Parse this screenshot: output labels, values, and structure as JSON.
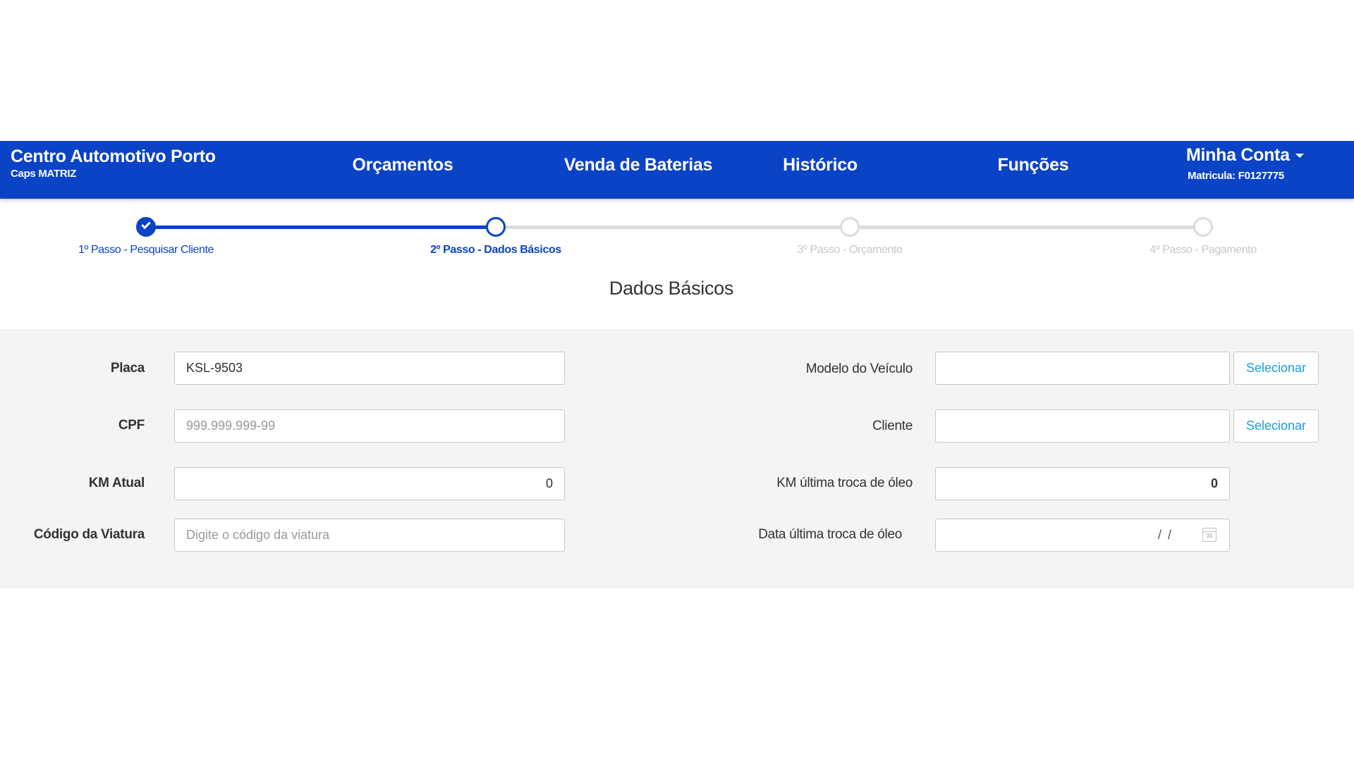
{
  "header": {
    "brand_name": "Centro Automotivo Porto",
    "brand_sub": "Caps MATRIZ",
    "nav": [
      "Orçamentos",
      "Venda de Baterias",
      "Histórico",
      "Funções"
    ],
    "account_label": "Minha Conta",
    "account_sub": "Matricula: F0127775",
    "bg_color": "#0a43c6"
  },
  "stepper": {
    "steps": [
      {
        "label": "1º Passo - Pesquisar Cliente",
        "state": "completed"
      },
      {
        "label": "2º Passo - Dados Básicos",
        "state": "current"
      },
      {
        "label": "3º Passo - Orçamento",
        "state": "pending"
      },
      {
        "label": "4º Passo - Pagamento",
        "state": "pending"
      }
    ]
  },
  "page_title": "Dados Básicos",
  "form": {
    "placa": {
      "label": "Placa",
      "value": "KSL-9503"
    },
    "cpf": {
      "label": "CPF",
      "placeholder": "999.999.999-99"
    },
    "km_atual": {
      "label": "KM Atual",
      "value": "0"
    },
    "codigo_viatura": {
      "label": "Código da Viatura",
      "placeholder": "Digite o código da viatura"
    },
    "modelo_veiculo": {
      "label": "Modelo do Veículo",
      "value": "",
      "button": "Selecionar"
    },
    "cliente": {
      "label": "Cliente",
      "value": "",
      "button": "Selecionar"
    },
    "km_ultima_troca": {
      "label": "KM última troca de óleo",
      "value": "0"
    },
    "data_ultima_troca": {
      "label": "Data última troca de óleo",
      "value": "/ /",
      "icon": "calendar-icon",
      "icon_text": "31"
    }
  }
}
